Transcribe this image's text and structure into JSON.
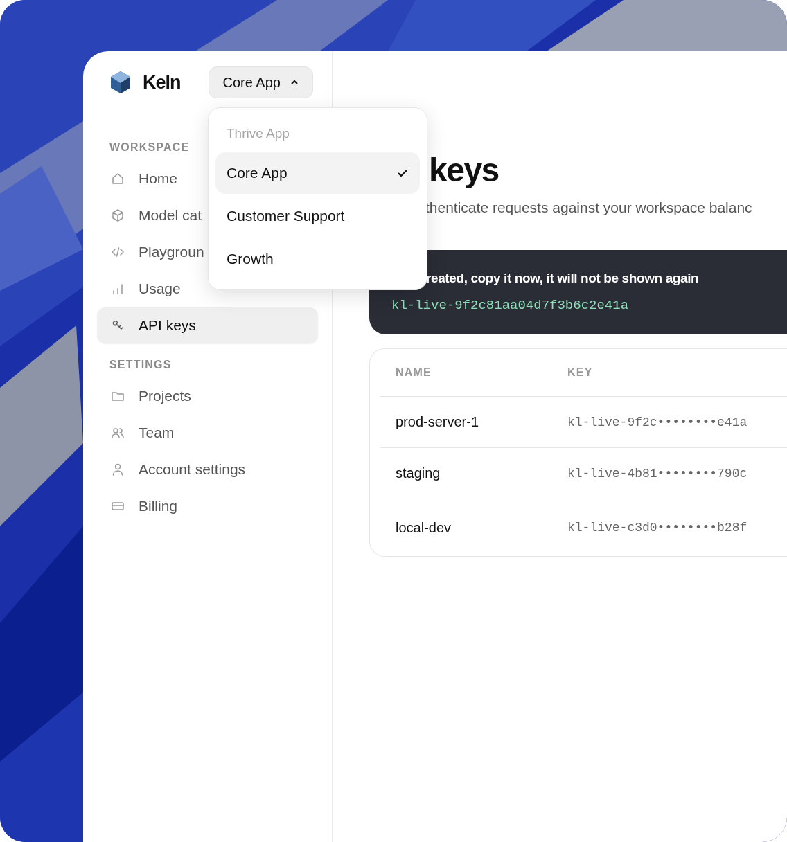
{
  "brand": {
    "name": "Keln"
  },
  "project_switcher": {
    "label": "Core App",
    "expanded": true
  },
  "project_menu": [
    {
      "label": "Thrive App",
      "selected": false,
      "disabled": true
    },
    {
      "label": "Core App",
      "selected": true,
      "disabled": false
    },
    {
      "label": "Customer Support",
      "selected": false,
      "disabled": false
    },
    {
      "label": "Growth",
      "selected": false,
      "disabled": false
    }
  ],
  "sidebar": {
    "sections": [
      {
        "title": "WORKSPACE",
        "items": [
          {
            "label": "Home",
            "kind": "home",
            "selected": false
          },
          {
            "label": "Model cat",
            "kind": "cube",
            "selected": false
          },
          {
            "label": "Playgroun",
            "kind": "code",
            "selected": false
          },
          {
            "label": "Usage",
            "kind": "chart",
            "selected": false
          },
          {
            "label": "API keys",
            "kind": "key",
            "selected": true
          }
        ]
      },
      {
        "title": "SETTINGS",
        "items": [
          {
            "label": "Projects",
            "kind": "folder",
            "selected": false
          },
          {
            "label": "Team",
            "kind": "team",
            "selected": false
          },
          {
            "label": "Account settings",
            "kind": "person",
            "selected": false
          },
          {
            "label": "Billing",
            "kind": "card",
            "selected": false
          }
        ]
      }
    ]
  },
  "page": {
    "title": "keys",
    "subtitle": "thenticate requests against your workspace balanc"
  },
  "banner": {
    "message": "reated, copy it now, it will not be shown again",
    "key": "kl-live-9f2c81aa04d7f3b6c2e41a"
  },
  "table": {
    "columns": [
      "NAME",
      "KEY"
    ],
    "rows": [
      {
        "name": "prod-server-1",
        "key": "kl-live-9f2c••••••••e41a"
      },
      {
        "name": "staging",
        "key": "kl-live-4b81••••••••790c"
      },
      {
        "name": "local-dev",
        "key": "kl-live-c3d0••••••••b28f"
      }
    ]
  }
}
